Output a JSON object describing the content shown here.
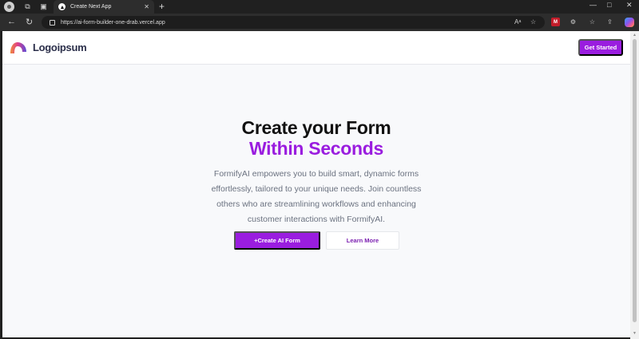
{
  "browser": {
    "tab_title": "Create Next App",
    "url": "https://ai-form-builder-one-drab.vercel.app",
    "tab_close": "✕",
    "new_tab": "+",
    "controls": {
      "minimize": "—",
      "maximize": "□",
      "close": "✕"
    },
    "nav": {
      "back": "←",
      "reload": "↻"
    }
  },
  "header": {
    "logo_text": "Logoipsum",
    "cta_label": "Get Started",
    "logo_colors": [
      "#f08a3c",
      "#e0408a",
      "#5a4bd6"
    ]
  },
  "hero": {
    "title_line1": "Create your Form",
    "title_line2": "Within Seconds",
    "description": "FormifyAI empowers you to build smart, dynamic forms effortlessly, tailored to your unique needs. Join countless others who are streamlining workflows and enhancing customer interactions with FormifyAI.",
    "primary_button": "+Create AI Form",
    "secondary_button": "Learn More"
  },
  "colors": {
    "accent": "#9a1ddf",
    "page_bg": "#f8f9fb",
    "text_dark": "#111111",
    "text_muted": "#6b7280"
  }
}
